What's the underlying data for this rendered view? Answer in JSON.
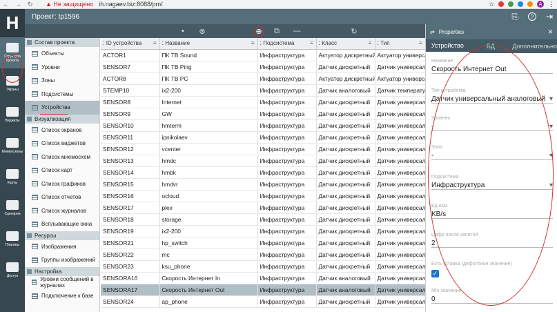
{
  "browser": {
    "warning": "Не защищено",
    "url": "ih.nagaev.biz:8088/pm/",
    "avatar": "A"
  },
  "header": {
    "title": "Проект: tp1596"
  },
  "leftnav": [
    {
      "label": "Структура проекта",
      "icon": "structure-icon"
    },
    {
      "label": "Экраны",
      "icon": "screen-icon"
    },
    {
      "label": "Виджеты",
      "icon": "widget-icon"
    },
    {
      "label": "Мнемосхемы",
      "icon": "mnemo-icon"
    },
    {
      "label": "Карты",
      "icon": "map-icon"
    },
    {
      "label": "Сценарии",
      "icon": "scenario-icon"
    },
    {
      "label": "Плагины",
      "icon": "plugin-icon"
    },
    {
      "label": "Доступ",
      "icon": "users-icon"
    }
  ],
  "tree": {
    "sections": [
      {
        "title": "Состав проекта",
        "items": [
          "Объекты",
          "Уровни",
          "Зоны",
          "Подсистемы",
          "Устройства"
        ]
      },
      {
        "title": "Визуализация",
        "items": [
          "Список экранов",
          "Список виджетов",
          "Список мнемосхем",
          "Список карт",
          "Список графиков",
          "Список отчетов",
          "Список журналов",
          "Всплывающие окна"
        ]
      },
      {
        "title": "Ресурсы",
        "items": [
          "Изображения",
          "Группы изображений"
        ]
      },
      {
        "title": "Настройка",
        "items": [
          "Уровни сообщений в журналах",
          "Подключение к базе"
        ]
      }
    ],
    "selected": "Устройства"
  },
  "table": {
    "columns": [
      "ID устройства",
      "Название",
      "Подсистема",
      "Класс",
      "Тип"
    ],
    "rows": [
      [
        "ACTOR1",
        "ПК ТВ Sound",
        "Инфраструктура",
        "Актуатор дискретный",
        "Актуатор универсаль"
      ],
      [
        "SENSOR7",
        "ПК ТВ Ping",
        "Инфраструктура",
        "Датчик дискретный",
        "Датчик универсальн"
      ],
      [
        "ACTOR8",
        "ПК ТВ PC",
        "Инфраструктура",
        "Актуатор дискретный",
        "Актуатор универсаль"
      ],
      [
        "STEMP10",
        "ix2-200",
        "Инфраструктура",
        "Датчик аналоговый",
        "Датчик температуры"
      ],
      [
        "SENSOR8",
        "Internet",
        "Инфраструктура",
        "Датчик дискретный",
        "Датчик универсальн"
      ],
      [
        "SENSOR9",
        "GW",
        "Инфраструктура",
        "Датчик дискретный",
        "Датчик универсальн"
      ],
      [
        "SENSOR10",
        "hmterm",
        "Инфраструктура",
        "Датчик дискретный",
        "Датчик универсальн"
      ],
      [
        "SENSOR11",
        "ipnikolaev",
        "Инфраструктура",
        "Датчик дискретный",
        "Датчик универсальн"
      ],
      [
        "SENSOR12",
        "vcenter",
        "Инфраструктура",
        "Датчик дискретный",
        "Датчик универсальн"
      ],
      [
        "SENSOR13",
        "hmdc",
        "Инфраструктура",
        "Датчик дискретный",
        "Датчик универсальн"
      ],
      [
        "SENSOR14",
        "hmbk",
        "Инфраструктура",
        "Датчик дискретный",
        "Датчик универсальн"
      ],
      [
        "SENSOR15",
        "hmdvr",
        "Инфраструктура",
        "Датчик дискретный",
        "Датчик универсальн"
      ],
      [
        "SENSOR16",
        "ocloud",
        "Инфраструктура",
        "Датчик дискретный",
        "Датчик универсальн"
      ],
      [
        "SENSOR17",
        "plex",
        "Инфраструктура",
        "Датчик дискретный",
        "Датчик универсальн"
      ],
      [
        "SENSOR18",
        "storage",
        "Инфраструктура",
        "Датчик дискретный",
        "Датчик универсальн"
      ],
      [
        "SENSOR19",
        "ix2-200",
        "Инфраструктура",
        "Датчик дискретный",
        "Датчик универсальн"
      ],
      [
        "SENSOR21",
        "hp_switch",
        "Инфраструктура",
        "Датчик дискретный",
        "Датчик универсальн"
      ],
      [
        "SENSOR22",
        "mc",
        "Инфраструктура",
        "Датчик дискретный",
        "Датчик универсальн"
      ],
      [
        "SENSOR23",
        "ksu_phone",
        "Инфраструктура",
        "Датчик дискретный",
        "Датчик универсальн"
      ],
      [
        "SENSORA16",
        "Скорость Интернет In",
        "Инфраструктура",
        "Датчик аналоговый",
        "Датчик универсальн"
      ],
      [
        "SENSORA17",
        "Скорость Интернет Out",
        "Инфраструктура",
        "Датчик аналоговый",
        "Датчик универсальн"
      ],
      [
        "SENSOR24",
        "ap_phone",
        "Инфраструктура",
        "Датчик дискретный",
        "Датчик универсальн"
      ]
    ],
    "selected_row": 20
  },
  "properties": {
    "title": "Properties",
    "tabs": [
      "Устройство",
      "БД",
      "Дополнительно"
    ],
    "fields": [
      {
        "label": "Название",
        "value": "Скорость Интернет Out",
        "dropdown": false
      },
      {
        "label": "Тип устройства",
        "value": "Датчик универсальный аналоговый",
        "dropdown": true
      },
      {
        "label": "Уровень",
        "value": "-",
        "dropdown": true
      },
      {
        "label": "Зона",
        "value": "-",
        "dropdown": true
      },
      {
        "label": "Подсистема",
        "value": "Инфраструктура",
        "dropdown": true
      },
      {
        "label": "Ед.изм.",
        "value": "KB/s",
        "dropdown": false
      },
      {
        "label": "Цифр после запятой",
        "value": "2",
        "dropdown": false
      },
      {
        "label": "Есть уставка (дефолтное значение)",
        "value": "",
        "dropdown": false,
        "checkbox": true
      },
      {
        "label": "Min значение",
        "value": "0",
        "dropdown": false
      }
    ]
  },
  "colors": {
    "topbar": "#546e7a",
    "leftbar": "#37474f",
    "selected": "#b0bec5",
    "annotation": "#d32f2f"
  }
}
